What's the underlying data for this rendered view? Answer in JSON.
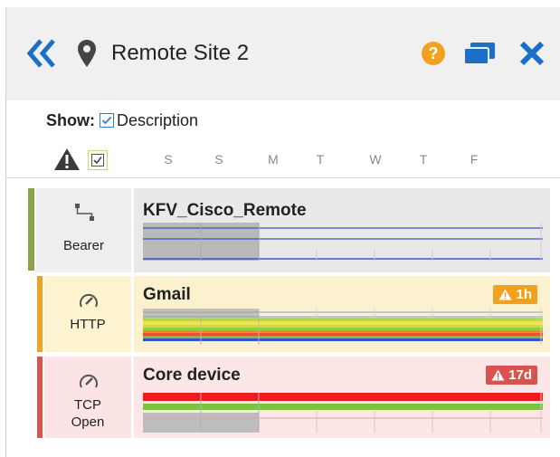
{
  "header": {
    "title": "Remote Site 2",
    "icons": [
      "double-chevron-left-icon",
      "map-pin-icon",
      "help-icon",
      "window-icon",
      "close-icon"
    ],
    "colors": {
      "chevron": "#1a6fc9",
      "help": "#f2a11e",
      "window": "#1a6fc9",
      "close": "#1a6fc9"
    }
  },
  "show": {
    "label": "Show:",
    "description_label": "Description",
    "description_checked": true
  },
  "filter": {
    "warning_checked": true
  },
  "days": [
    "S",
    "S",
    "M",
    "T",
    "W",
    "T",
    "F"
  ],
  "rows": [
    {
      "type_label": "Bearer",
      "title": "KFV_Cisco_Remote",
      "accent": "#8aa24a",
      "bg": "#ececec",
      "icon": "topology-icon",
      "badge": null
    },
    {
      "type_label": "HTTP",
      "title": "Gmail",
      "accent": "#f0a320",
      "bg": "#fdf4cf",
      "icon": "gauge-icon",
      "badge": {
        "text": "1h",
        "color": "#f2a11e"
      }
    },
    {
      "type_label_line1": "TCP",
      "type_label_line2": "Open",
      "title": "Core device",
      "accent": "#d9534f",
      "bg": "#fde6e6",
      "icon": "gauge-icon",
      "badge": {
        "text": "17d",
        "color": "#d9534f"
      }
    }
  ]
}
